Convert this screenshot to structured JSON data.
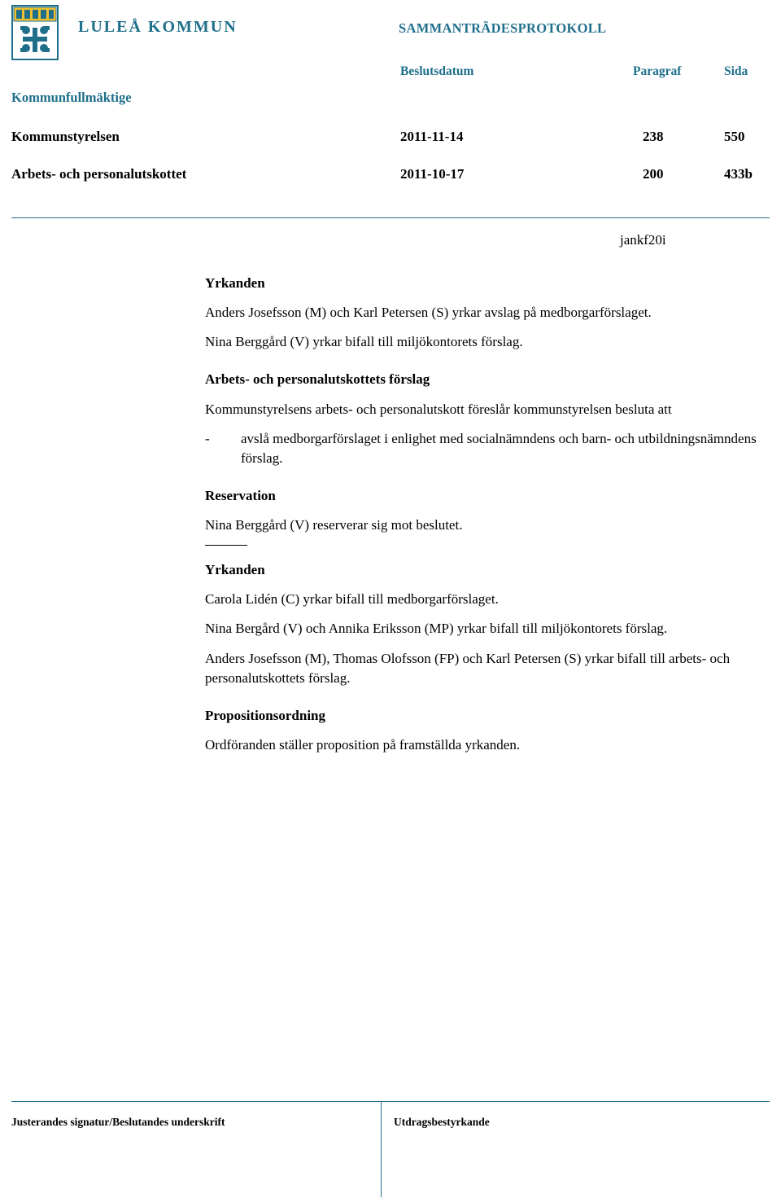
{
  "header": {
    "organization": "LULEÅ KOMMUN",
    "document_type": "SAMMANTRÄDESPROTOKOLL",
    "board": "Kommunfullmäktige",
    "columns": {
      "date": "Beslutsdatum",
      "paragraph": "Paragraf",
      "page": "Sida"
    },
    "rows": [
      {
        "label": "Kommunstyrelsen",
        "date": "2011-11-14",
        "paragraph": "238",
        "page": "550"
      },
      {
        "label": "Arbets- och personalutskottet",
        "date": "2011-10-17",
        "paragraph": "200",
        "page": "433b"
      }
    ]
  },
  "document_id": "jankf20i",
  "body": {
    "yrkanden_heading_1": "Yrkanden",
    "yrkanden_p1": "Anders Josefsson (M) och Karl Petersen (S) yrkar avslag på medborgarförslaget.",
    "yrkanden_p2": "Nina Berggård (V) yrkar bifall till miljökontorets förslag.",
    "forslag_heading": "Arbets- och personalutskottets förslag",
    "forslag_p1": "Kommunstyrelsens arbets- och personalutskott föreslår kommunstyrelsen besluta att",
    "forslag_bullet_dash": "-",
    "forslag_bullet_text": "avslå medborgarförslaget i enlighet med socialnämndens och barn- och utbildningsnämndens förslag.",
    "reservation_heading": "Reservation",
    "reservation_p1": "Nina Berggård (V) reserverar sig mot beslutet.",
    "yrkanden_heading_2": "Yrkanden",
    "yrkanden2_p1": "Carola Lidén (C) yrkar bifall till medborgarförslaget.",
    "yrkanden2_p2": "Nina Bergård (V) och Annika Eriksson (MP) yrkar bifall till miljökontorets förslag.",
    "yrkanden2_p3": "Anders Josefsson (M), Thomas Olofsson (FP) och Karl Petersen (S) yrkar bifall till arbets- och personalutskottets förslag.",
    "proposition_heading": "Propositionsordning",
    "proposition_p1": "Ordföranden ställer proposition på framställda yrkanden."
  },
  "footer": {
    "left": "Justerandes signatur/Beslutandes underskrift",
    "right": "Utdragsbestyrkande"
  },
  "colors": {
    "accent": "#1f6f8b",
    "text": "#000000"
  }
}
